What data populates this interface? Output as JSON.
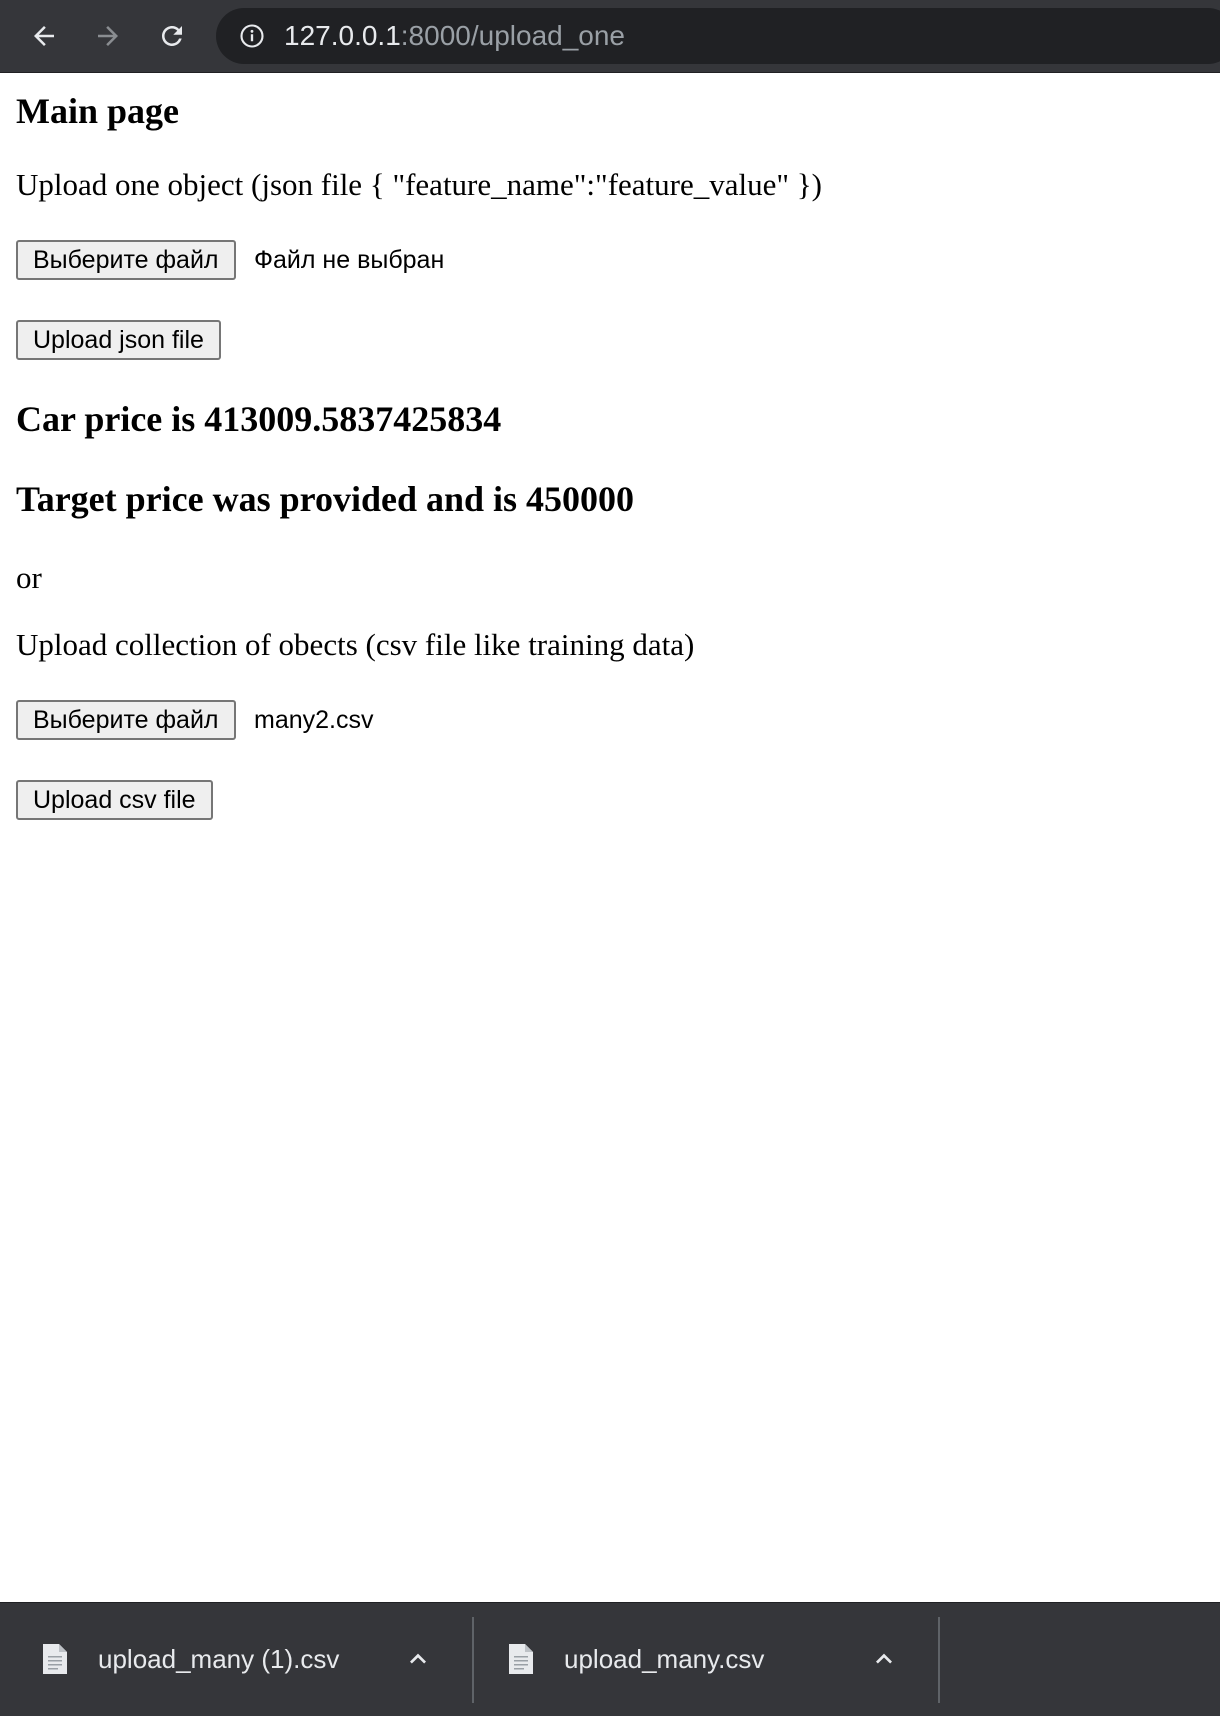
{
  "browser": {
    "url_host": "127.0.0.1",
    "url_rest": ":8000/upload_one"
  },
  "page": {
    "title": "Main page",
    "upload_one_label": "Upload one object (json file { \"feature_name\":\"feature_value\" })",
    "json_section": {
      "choose_button": "Выберите файл",
      "file_status": "Файл не выбран",
      "upload_button": "Upload json file"
    },
    "result_price": "Car price is 413009.5837425834",
    "result_target": "Target price was provided and is 450000",
    "or_text": "or",
    "upload_collection_label": "Upload collection of obects (csv file like training data)",
    "csv_section": {
      "choose_button": "Выберите файл",
      "file_status": "many2.csv",
      "upload_button": "Upload csv file"
    }
  },
  "downloads": [
    {
      "name": "upload_many (1).csv",
      "icon": "file-icon"
    },
    {
      "name": "upload_many.csv",
      "icon": "file-icon"
    }
  ],
  "colors": {
    "toolbar_bg": "#35363a",
    "omnibox_bg": "#202124",
    "url_host": "#e8eaed",
    "url_rest": "#9aa0a6"
  }
}
